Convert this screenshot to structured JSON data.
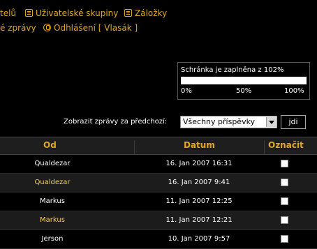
{
  "nav": {
    "members_tail": "telů",
    "usergroups": "Uživatelské skupiny",
    "bookmarks": "Záložky",
    "messages_tail": "é zprávy",
    "logout": "Odhlášení [ Vlasák ]"
  },
  "inbox": {
    "title": "Schránka je zaplněna z 102%",
    "fill_percent": 100,
    "scale_0": "0%",
    "scale_50": "50%",
    "scale_100": "100%"
  },
  "filter": {
    "label": "Zobrazit zprávy za předchozí:",
    "selected": "Všechny příspěvky",
    "go": "jdi"
  },
  "table": {
    "headers": {
      "from": "Od",
      "date": "Datum",
      "mark": "Označit"
    },
    "rows": [
      {
        "from": "Qualdezar",
        "date": "16. Jan 2007 16:31"
      },
      {
        "from": "Qualdezar",
        "date": "16. Jan 2007 9:41"
      },
      {
        "from": "Markus",
        "date": "11. Jan 2007 12:25"
      },
      {
        "from": "Markus",
        "date": "11. Jan 2007 12:21"
      },
      {
        "from": "Jerson",
        "date": "10. Jan 2007 9:57"
      }
    ]
  },
  "colors": {
    "accent": "#e0a820",
    "background": "#000000"
  }
}
